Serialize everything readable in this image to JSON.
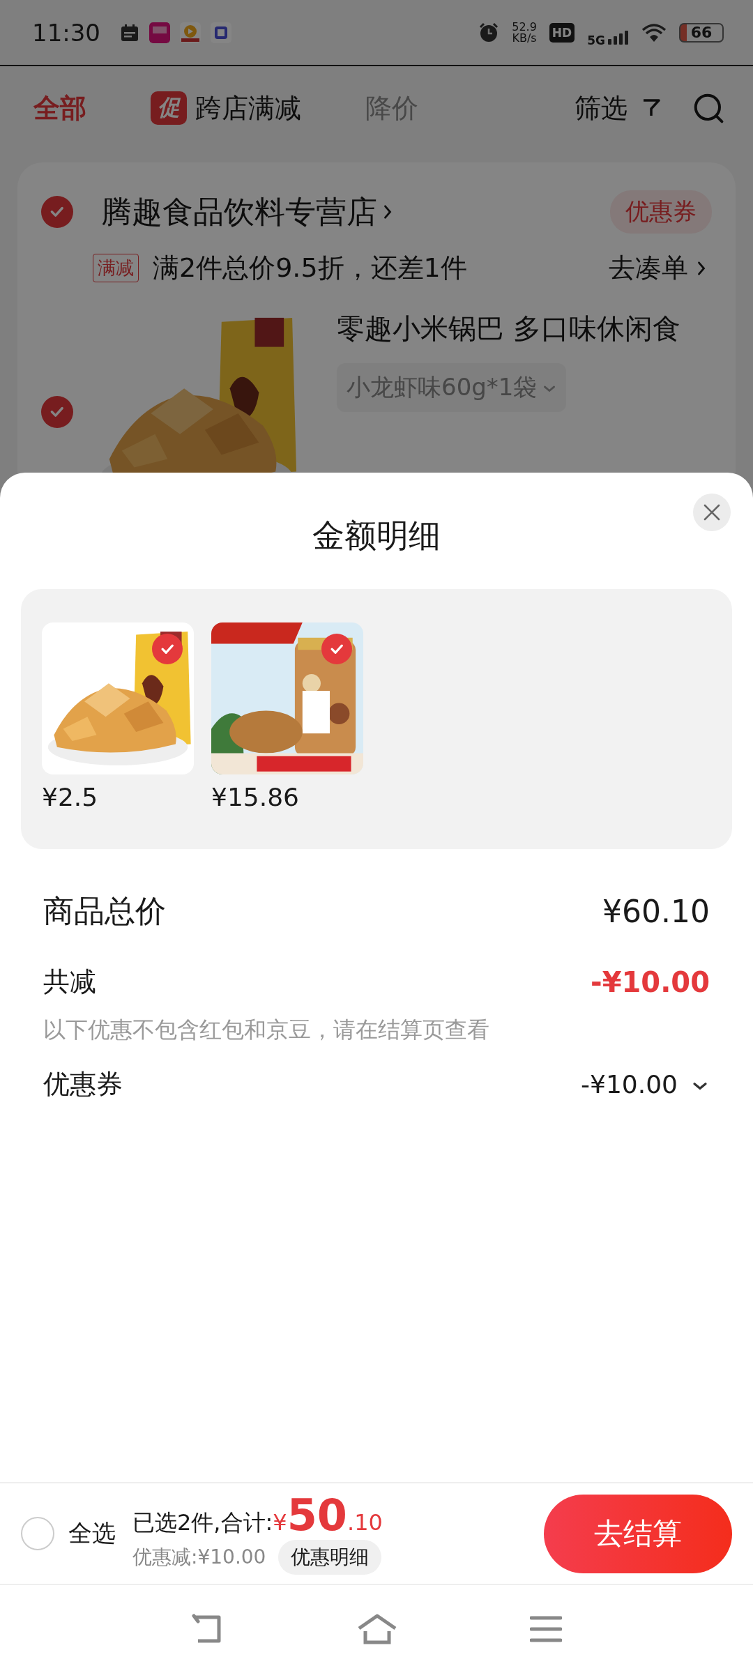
{
  "status_bar": {
    "time": "11:30",
    "speed": "52.9",
    "speed_unit": "KB/s",
    "hd": "HD",
    "network": "5G",
    "battery": "66"
  },
  "tabs": [
    {
      "label": "全部",
      "selected": true,
      "disabled": false
    },
    {
      "label": "跨店满减",
      "badge": "促",
      "selected": false,
      "disabled": false
    },
    {
      "label": "降价",
      "selected": false,
      "disabled": true
    }
  ],
  "filter": {
    "label": "筛选"
  },
  "store": {
    "checked": true,
    "name": "腾趣食品饮料专营店",
    "coupon": "优惠券",
    "promo_tag": "满减",
    "promo_text": "满2件总价9.5折，还差1件",
    "promo_link": "去凑单"
  },
  "item": {
    "checked": true,
    "title": "零趣小米锅巴 多口味休闲食",
    "variant": "小龙虾味60g*1袋"
  },
  "sheet": {
    "title": "金额明细",
    "items": [
      {
        "price": "¥2.5",
        "checked": true,
        "kind": "chips"
      },
      {
        "price": "¥15.86",
        "checked": true,
        "kind": "nuts"
      }
    ],
    "total_label": "商品总价",
    "total": "¥60.10",
    "discount_label": "共减",
    "discount": "-¥10.00",
    "note": "以下优惠不包含红包和京豆，请在结算页查看",
    "coupon_label": "优惠券",
    "coupon": "-¥10.00",
    "coupon_expanded": false
  },
  "checkout": {
    "select_all_checked": false,
    "select_all": "全选",
    "summary": "已选2件,合计:",
    "currency": "¥",
    "amount_int": "50",
    "amount_dec": ".10",
    "saving": "优惠减:¥10.00",
    "detail_button": "优惠明细",
    "submit": "去结算"
  }
}
